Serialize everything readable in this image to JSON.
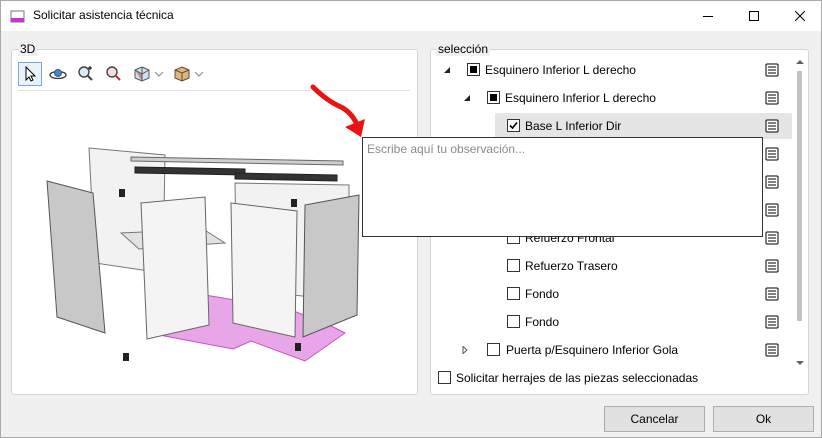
{
  "window": {
    "title": "Solicitar asistencia técnica",
    "accent_color": "#cc33cc"
  },
  "viewer": {
    "group_label": "3D",
    "toolbar": {
      "tools": [
        {
          "icon": "pointer-icon",
          "active": true
        },
        {
          "icon": "orbit-icon"
        },
        {
          "icon": "zoom-extents-icon"
        },
        {
          "icon": "zoom-window-icon"
        },
        {
          "icon": "view-cube-icon",
          "has_dropdown": true
        },
        {
          "icon": "box-render-icon",
          "has_dropdown": true
        }
      ]
    },
    "highlight_color": "#e8a6e8"
  },
  "selection": {
    "group_label": "selección",
    "items": [
      {
        "label": "Esquinero Inferior L derecho",
        "expanded": true,
        "check": "partial"
      },
      {
        "label": "Esquinero Inferior L derecho",
        "expanded": true,
        "check": "partial"
      },
      {
        "label": "Base L Inferior Dir",
        "check": "checked",
        "selected": true
      },
      {
        "label": "Refuerzo Frontal",
        "check": "unchecked"
      },
      {
        "label": "Refuerzo Trasero",
        "check": "unchecked"
      },
      {
        "label": "Fondo",
        "check": "unchecked"
      },
      {
        "label": "Fondo",
        "check": "unchecked"
      },
      {
        "label": "Puerta p/Esquinero Inferior Gola",
        "expanded": false,
        "check": "unchecked"
      }
    ],
    "observation_placeholder": "Escribe aquí tu observación...",
    "hardware_request_label": "Solicitar herrajes de las piezas seleccionadas"
  },
  "buttons": {
    "cancel": "Cancelar",
    "ok": "Ok"
  },
  "annotation": {
    "arrow_color": "#ee1111"
  }
}
